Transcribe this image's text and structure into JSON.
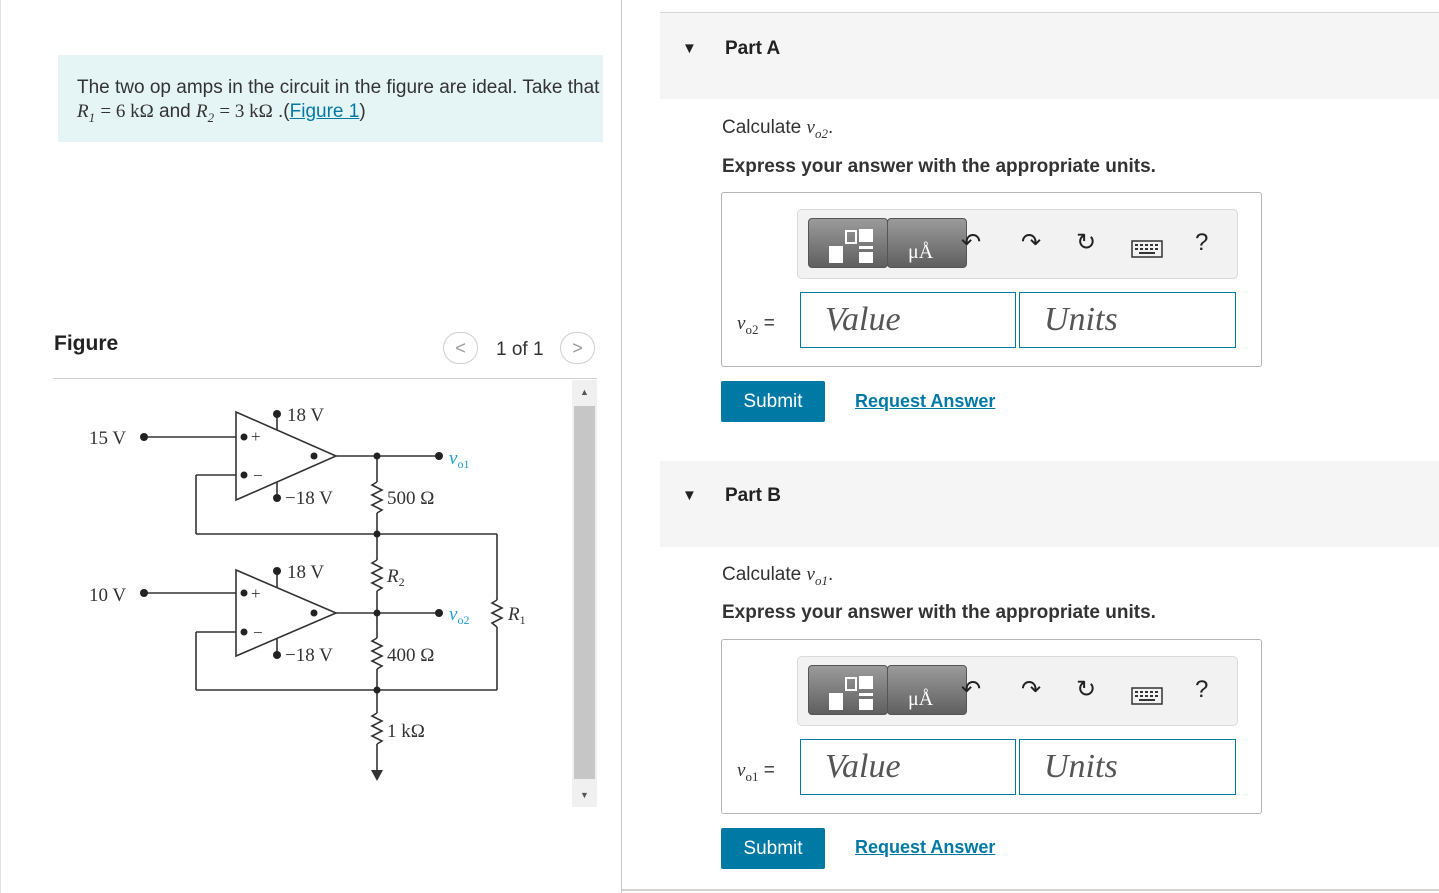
{
  "problem": {
    "text_prefix": "The two op amps in the circuit in the figure are ideal. Take that",
    "r1_symbol": "R",
    "r1_sub": "1",
    "r1_value": "= 6 kΩ",
    "and_text": "and",
    "r2_symbol": "R",
    "r2_sub": "2",
    "r2_value": "= 3 kΩ",
    "link_prefix": ".(",
    "figure_link": "Figure 1",
    "link_suffix": ")"
  },
  "figure": {
    "label": "Figure",
    "prev_icon": "<",
    "pager": "1 of 1",
    "next_icon": ">",
    "circuit_labels": {
      "v_in1": "15 V",
      "v_in2": "10 V",
      "supply_pos_1": "18 V",
      "supply_neg_1": "−18 V",
      "supply_pos_2": "18 V",
      "supply_neg_2": "−18 V",
      "r_500": "500 Ω",
      "r_400": "400 Ω",
      "r_1k": "1 kΩ",
      "r2": "R",
      "r2_sub": "2",
      "r1": "R",
      "r1_sub": "1",
      "vo1": "v",
      "vo1_sub": "o1",
      "vo2": "v",
      "vo2_sub": "o2",
      "plus": "+",
      "minus": "−"
    }
  },
  "parts": [
    {
      "caret": "▼",
      "title": "Part A",
      "calc_prefix": "Calculate",
      "var": "v",
      "var_sub": "o2",
      "calc_suffix": ".",
      "express": "Express your answer with the appropriate units.",
      "var_label_sym": "v",
      "var_label_sub": "o2",
      "var_label_eq": "=",
      "value_placeholder": "Value",
      "units_placeholder": "Units",
      "submit": "Submit",
      "request": "Request Answer"
    },
    {
      "caret": "▼",
      "title": "Part B",
      "calc_prefix": "Calculate",
      "var": "v",
      "var_sub": "o1",
      "calc_suffix": ".",
      "express": "Express your answer with the appropriate units.",
      "var_label_sym": "v",
      "var_label_sub": "o1",
      "var_label_eq": "=",
      "value_placeholder": "Value",
      "units_placeholder": "Units",
      "submit": "Submit",
      "request": "Request Answer"
    }
  ],
  "toolbar": {
    "units_glyph": "μÅ",
    "undo_icon": "↶",
    "redo_icon": "↷",
    "reset_icon": "↻",
    "keyboard_icon": "keyboard-icon",
    "help": "?"
  },
  "colors": {
    "accent": "#007aa5",
    "problem_bg": "#e5f4f5",
    "header_bg": "#f5f5f5",
    "vout_label": "#1a9fd0"
  }
}
